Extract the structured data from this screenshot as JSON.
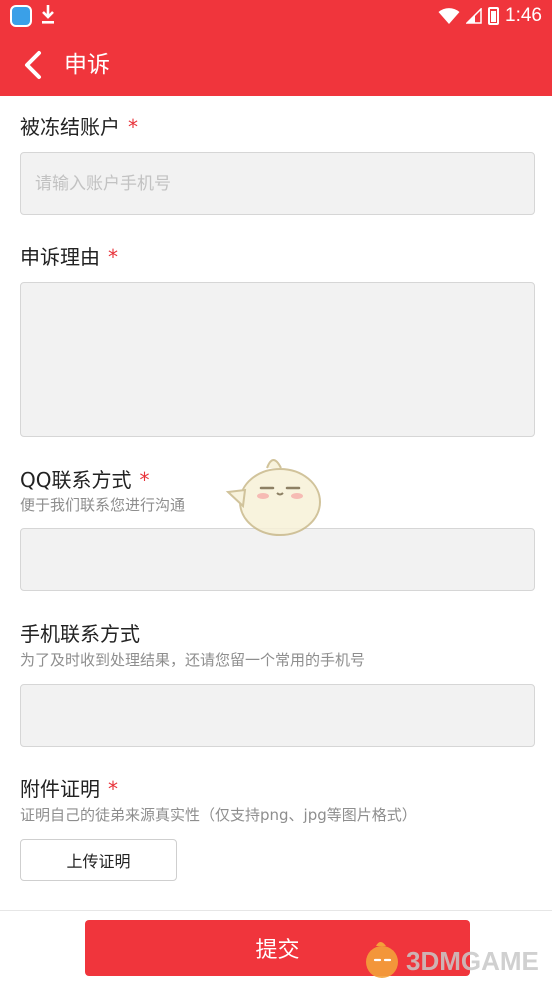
{
  "status_bar": {
    "time": "1:46",
    "icons": [
      "app-icon",
      "download-icon",
      "wifi-icon",
      "signal-icon",
      "battery-icon"
    ]
  },
  "app_bar": {
    "title": "申诉",
    "back_icon": "chevron-left-icon"
  },
  "form": {
    "frozen_account": {
      "label": "被冻结账户",
      "required_mark": "*",
      "placeholder": "请输入账户手机号"
    },
    "appeal_reason": {
      "label": "申诉理由",
      "required_mark": "*"
    },
    "qq_contact": {
      "label": "QQ联系方式",
      "required_mark": "*",
      "hint": "便于我们联系您进行沟通"
    },
    "phone_contact": {
      "label": "手机联系方式",
      "hint": "为了及时收到处理结果，还请您留一个常用的手机号"
    },
    "attachment": {
      "label": "附件证明",
      "required_mark": "*",
      "hint": "证明自己的徒弟来源真实性（仅支持png、jpg等图片格式）",
      "upload_label": "上传证明"
    },
    "submit_label": "提交"
  },
  "watermark": {
    "text": "3DMGAME"
  },
  "colors": {
    "brand_red": "#f0353c",
    "field_bg": "#f2f2f2",
    "hint_gray": "#8e8e8e"
  }
}
